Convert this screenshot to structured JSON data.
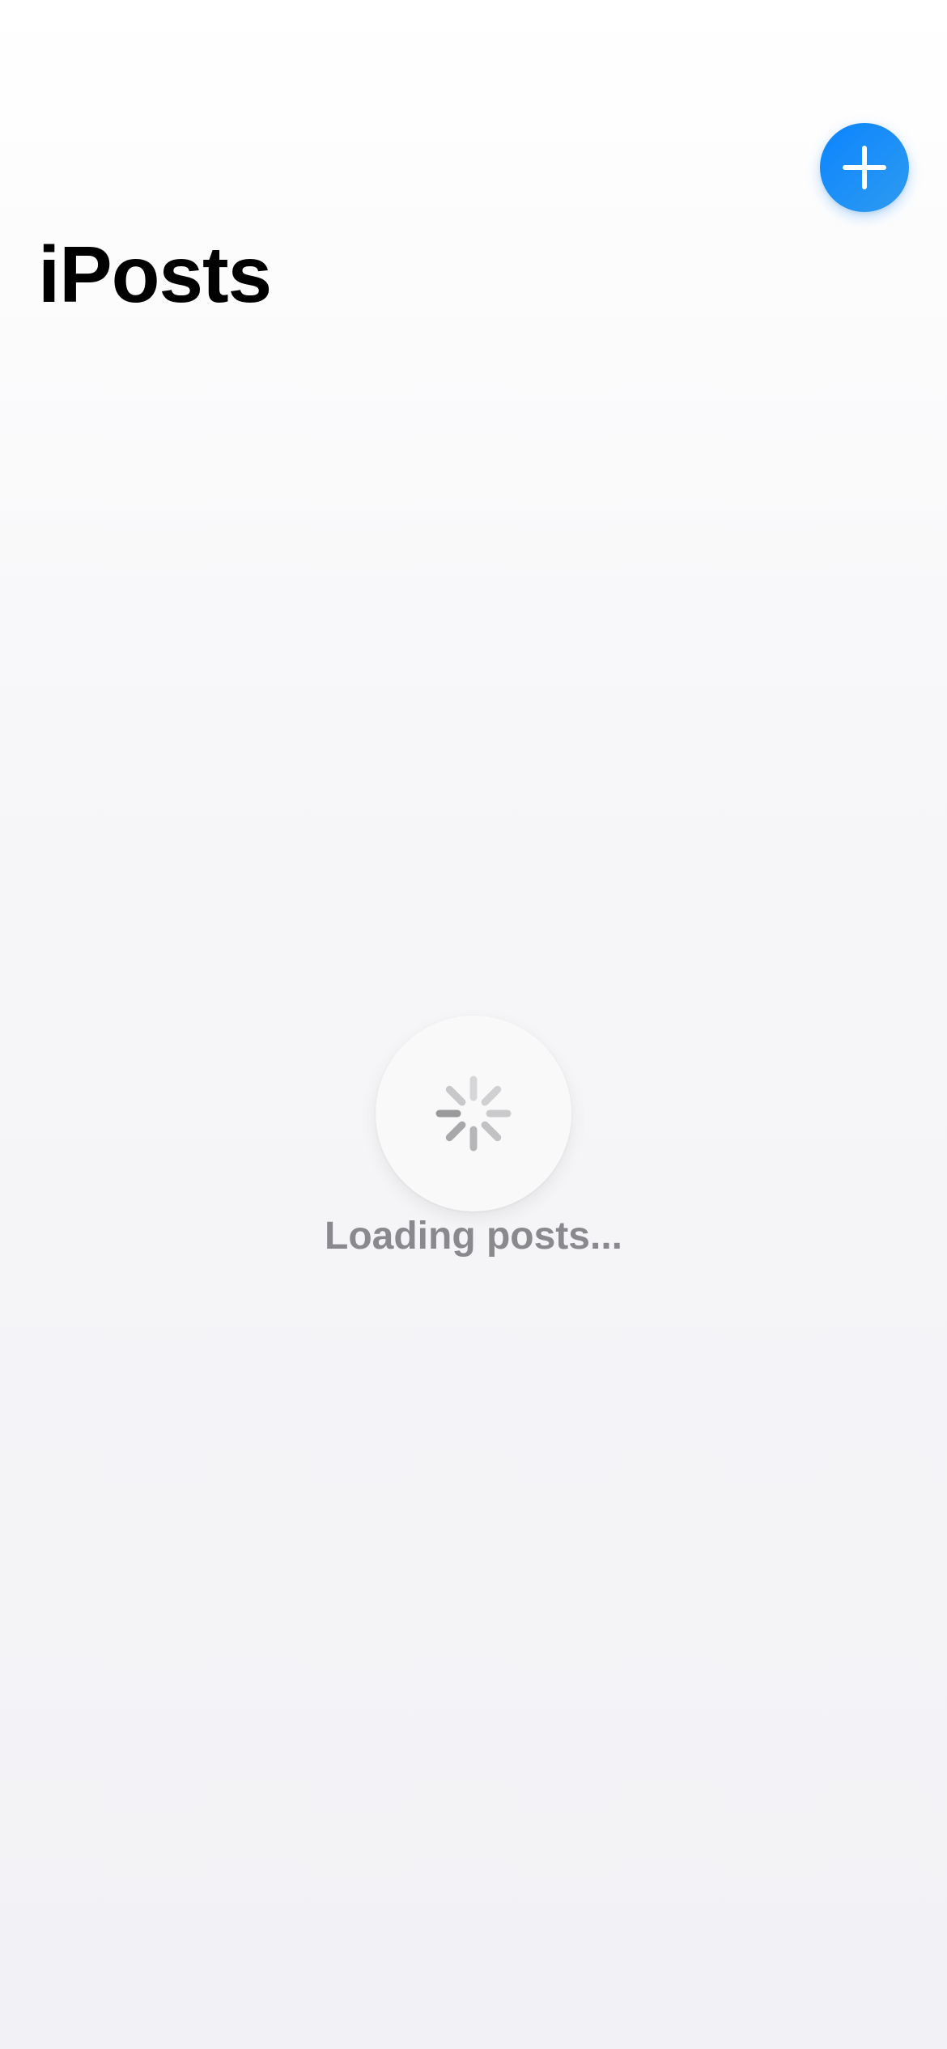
{
  "header": {
    "title": "iPosts"
  },
  "toolbar": {
    "add_icon": "plus-icon"
  },
  "loader": {
    "icon": "spinner-icon",
    "text": "Loading posts..."
  },
  "colors": {
    "accent": "#0a84ff",
    "title": "#000000",
    "secondary_text": "#8a8a8e",
    "background_top": "#ffffff",
    "background_bottom": "#f2f2f6"
  }
}
